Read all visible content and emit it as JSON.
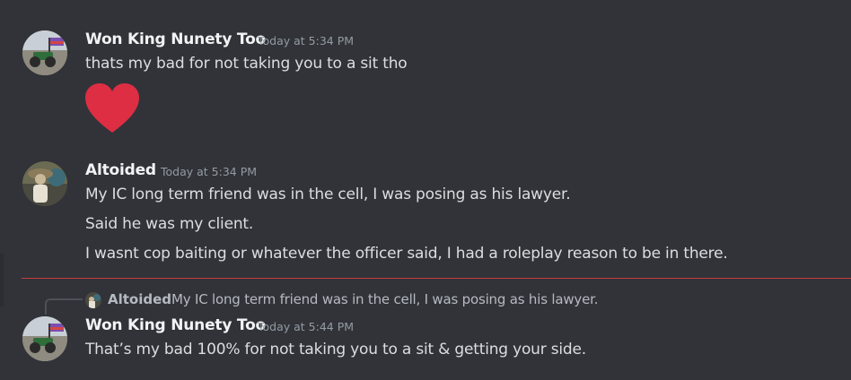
{
  "messages": [
    {
      "author": "Won King Nunety Too",
      "time": "Today at 5:34 PM",
      "lines": [
        "thats my bad for not taking you to a sit tho"
      ],
      "reaction_icon": "heart-icon",
      "avatar_icon": "monster-truck-avatar"
    },
    {
      "author": "Altoided",
      "time": "Today at 5:34 PM",
      "lines": [
        "My IC long term friend was in the cell, I was posing as his lawyer.",
        "Said he was my client.",
        "I wasnt cop baiting or whatever the officer said, I had a roleplay reason to be in there."
      ],
      "avatar_icon": "figure-avatar"
    },
    {
      "reply_to": {
        "author": "Altoided",
        "text": "My IC long term friend was in the cell, I was posing as his lawyer."
      },
      "author": "Won King Nunety Too",
      "time": "Today at 5:44 PM",
      "lines": [
        "That’s my bad 100% for not taking you to a sit & getting your side."
      ],
      "avatar_icon": "monster-truck-avatar"
    }
  ],
  "colors": {
    "background": "#313338",
    "new_messages_divider": "#c93b3e",
    "heart": "#dd2e44"
  }
}
